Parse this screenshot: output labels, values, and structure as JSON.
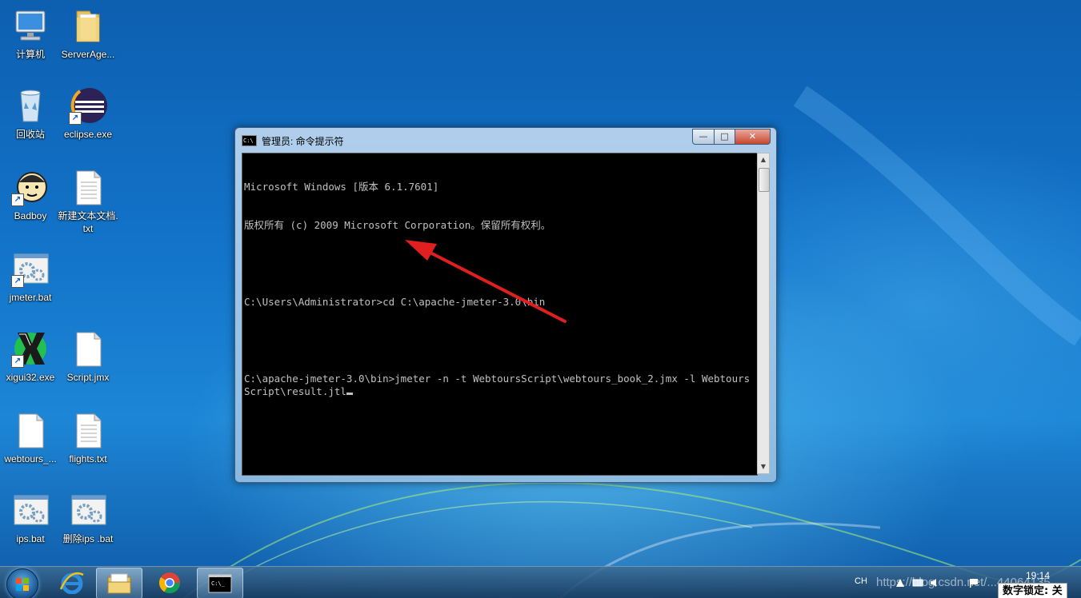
{
  "desktop": {
    "icons": [
      {
        "label": "计算机",
        "icon": "computer-icon"
      },
      {
        "label": "ServerAge...",
        "icon": "folder-icon"
      },
      {
        "label": "回收站",
        "icon": "recycle-bin-icon"
      },
      {
        "label": "eclipse.exe",
        "icon": "eclipse-icon"
      },
      {
        "label": "Badboy",
        "icon": "badboy-icon"
      },
      {
        "label": "新建文本文档.txt",
        "icon": "text-file-icon"
      },
      {
        "label": "jmeter.bat",
        "icon": "batch-file-icon"
      },
      {
        "label": "xigui32.exe",
        "icon": "xigui-icon"
      },
      {
        "label": "Script.jmx",
        "icon": "blank-file-icon"
      },
      {
        "label": "webtours_...",
        "icon": "blank-file-icon"
      },
      {
        "label": "flights.txt",
        "icon": "text-file-icon"
      },
      {
        "label": "ips.bat",
        "icon": "batch-file-icon"
      },
      {
        "label": "删除ips .bat",
        "icon": "batch-file-icon"
      }
    ]
  },
  "window": {
    "title": "管理员: 命令提示符",
    "icon": "cmd-icon",
    "controls": {
      "minimize": "—",
      "maximize": "□",
      "close": "✕"
    },
    "console_lines": [
      "Microsoft Windows [版本 6.1.7601]",
      "版权所有 (c) 2009 Microsoft Corporation。保留所有权利。",
      "",
      "C:\\Users\\Administrator>cd C:\\apache-jmeter-3.0\\bin",
      "",
      "C:\\apache-jmeter-3.0\\bin>jmeter -n -t WebtoursScript\\webtours_book_2.jmx -l WebtoursScript\\result.jtl"
    ]
  },
  "taskbar": {
    "start": "start-orb-icon",
    "pinned": [
      {
        "name": "ie-icon"
      },
      {
        "name": "explorer-icon"
      },
      {
        "name": "chrome-icon"
      },
      {
        "name": "cmd-icon"
      }
    ],
    "tray": {
      "language": "CH",
      "time": "19:14",
      "watermark": "https://blog.csdn.net/...44064135",
      "numlock": "数字锁定: 关"
    }
  },
  "colors": {
    "console_bg": "#000000",
    "console_fg": "#c0c0c0",
    "annotation_arrow": "#e02020"
  }
}
